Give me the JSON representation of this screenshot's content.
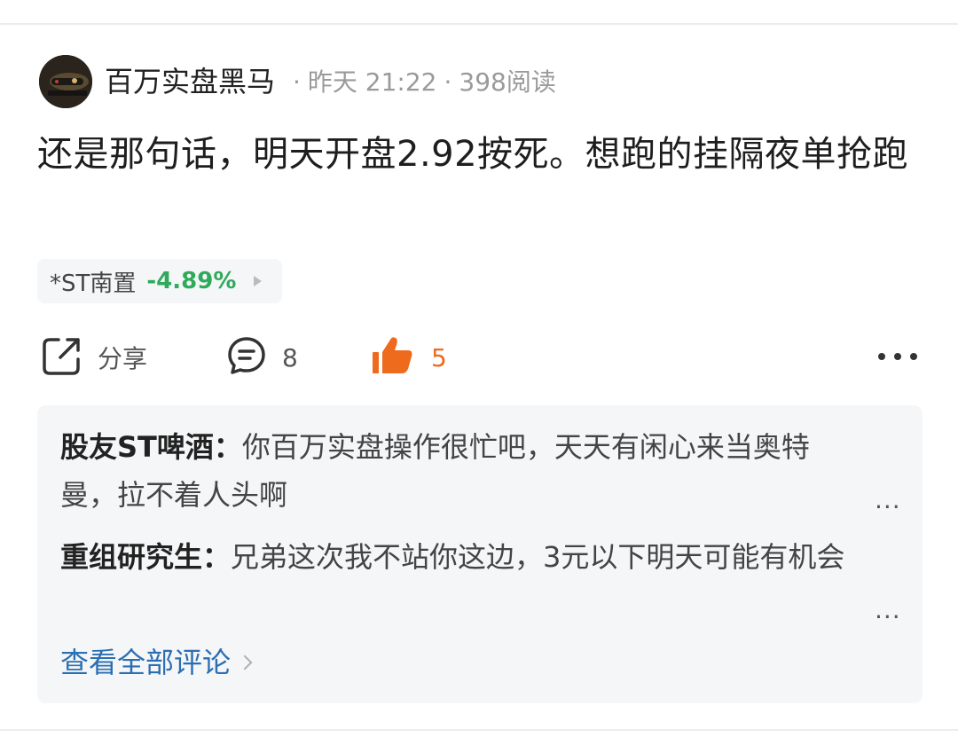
{
  "post": {
    "author": "百万实盘黑马",
    "separator": "·",
    "time": "昨天 21:22",
    "reads": "398阅读",
    "text": "还是那句话，明天开盘2.92按死。想跑的挂隔夜单抢跑"
  },
  "stock": {
    "name": "*ST南置",
    "change": "-4.89%",
    "change_color": "#2eaa5a"
  },
  "actions": {
    "share_label": "分享",
    "share_icon": "share-icon",
    "comment_count": "8",
    "comment_icon": "comment-icon",
    "like_count": "5",
    "like_icon": "thumbs-up-icon",
    "like_color": "#ee6a1c",
    "more_icon": "more-icon"
  },
  "comments": [
    {
      "author": "股友ST啤酒",
      "colon": "：",
      "text": "你百万实盘操作很忙吧，天天有闲心来当奥特曼，拉不着人头啊",
      "more": "..."
    },
    {
      "author": "重组研究生",
      "colon": "：",
      "text": "兄弟这次我不站你这边，3元以下明天可能有机会",
      "more": "..."
    }
  ],
  "view_all_label": "查看全部评论",
  "link_color": "#2b6fb3"
}
